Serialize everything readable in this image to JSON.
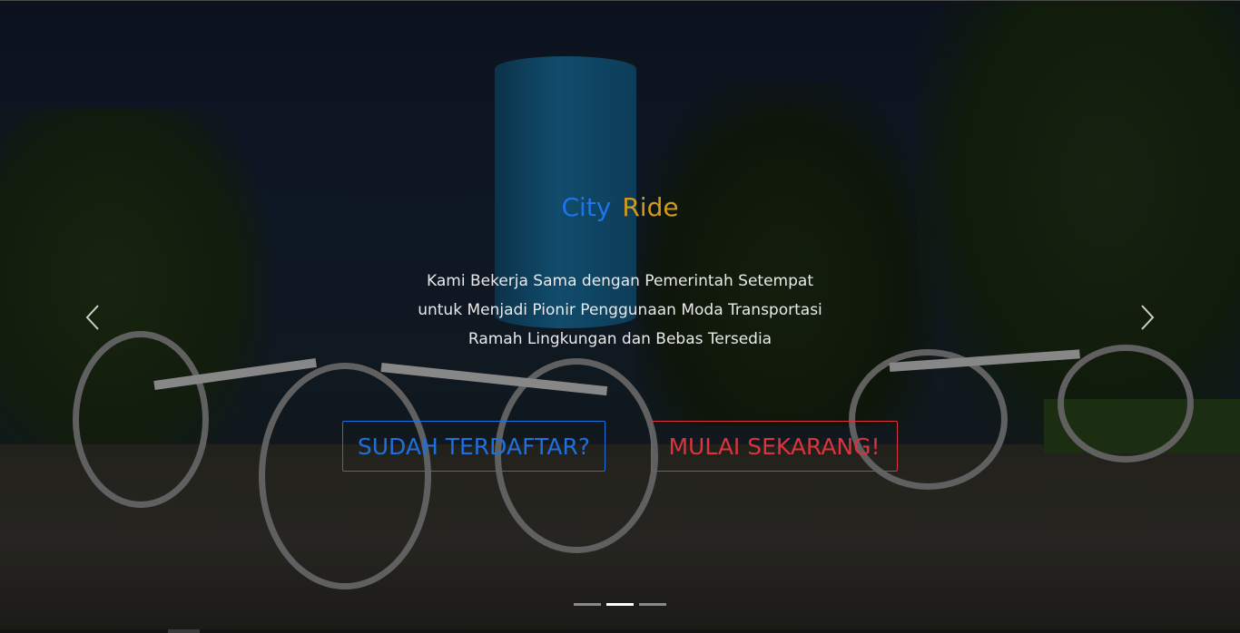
{
  "hero": {
    "title_part1": "City",
    "title_part2": "Ride",
    "description_line1": "Kami Bekerja Sama dengan Pemerintah Setempat",
    "description_line2": "untuk Menjadi Pionir Penggunaan Moda Transportasi",
    "description_line3": "Ramah Lingkungan dan Bebas Tersedia",
    "login_button": "SUDAH TERDAFTAR?",
    "start_button": "MULAI SEKARANG!"
  },
  "carousel": {
    "slide_count": 3,
    "active_index": 1
  },
  "colors": {
    "title_city": "#1e74e8",
    "title_ride": "#d19a18",
    "login_accent": "#1e6fe0",
    "start_accent": "#d9343f"
  },
  "icons": {
    "prev": "chevron-left-icon",
    "next": "chevron-right-icon"
  }
}
